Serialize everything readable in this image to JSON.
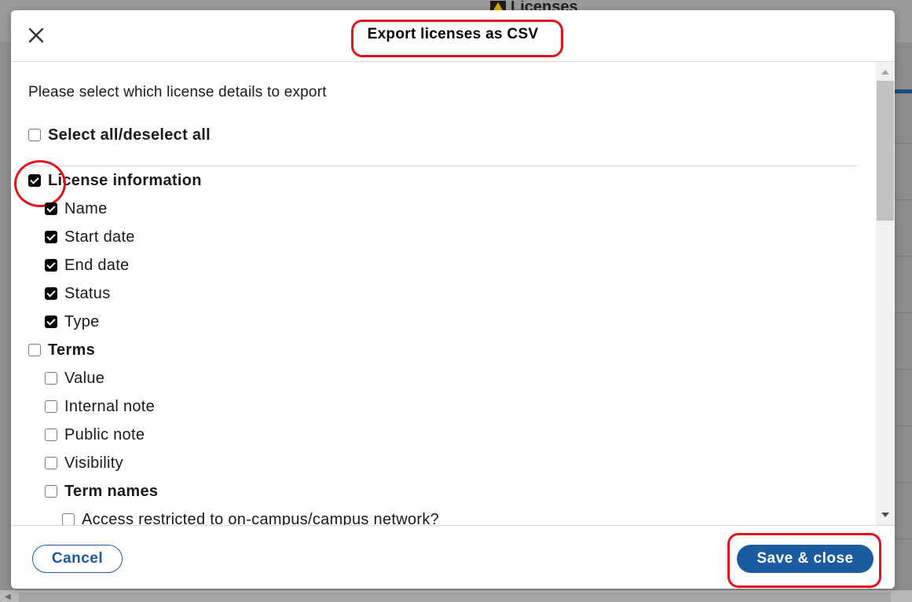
{
  "background": {
    "app_title": "Licenses",
    "app_icon": "licenses-app-icon"
  },
  "modal": {
    "title": "Export licenses as CSV",
    "close_icon": "close-icon",
    "intro": "Please select which license details to export",
    "select_all_label": "Select all/deselect all",
    "sections": {
      "license_information": {
        "label": "License information",
        "checked": true,
        "fields": [
          {
            "label": "Name",
            "checked": true
          },
          {
            "label": "Start date",
            "checked": true
          },
          {
            "label": "End date",
            "checked": true
          },
          {
            "label": "Status",
            "checked": true
          },
          {
            "label": "Type",
            "checked": true
          }
        ]
      },
      "terms": {
        "label": "Terms",
        "checked": false,
        "fields": [
          {
            "label": "Value",
            "checked": false
          },
          {
            "label": "Internal note",
            "checked": false
          },
          {
            "label": "Public note",
            "checked": false
          },
          {
            "label": "Visibility",
            "checked": false
          }
        ],
        "term_names": {
          "label": "Term names",
          "checked": false,
          "items": [
            {
              "label": "Access restricted to on-campus/campus network?",
              "checked": false
            }
          ]
        }
      }
    },
    "footer": {
      "cancel_label": "Cancel",
      "save_label": "Save & close"
    }
  },
  "colors": {
    "primary": "#1a5ba1",
    "annotation": "#e0141e"
  }
}
